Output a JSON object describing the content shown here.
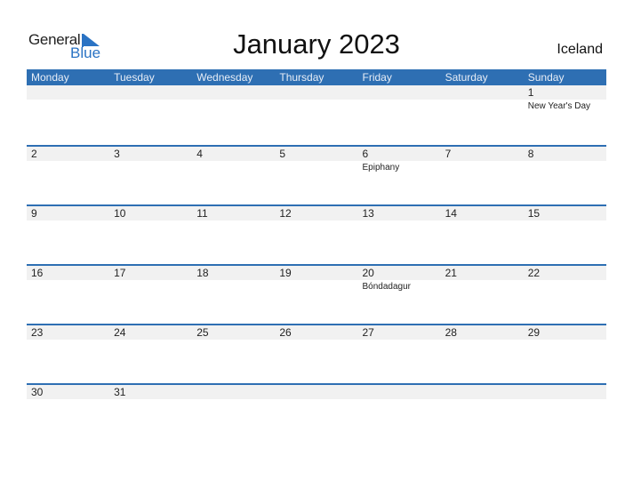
{
  "logo": {
    "general": "General",
    "blue": "Blue"
  },
  "title": "January 2023",
  "country": "Iceland",
  "days": [
    "Monday",
    "Tuesday",
    "Wednesday",
    "Thursday",
    "Friday",
    "Saturday",
    "Sunday"
  ],
  "weeks": [
    [
      {
        "d": ""
      },
      {
        "d": ""
      },
      {
        "d": ""
      },
      {
        "d": ""
      },
      {
        "d": ""
      },
      {
        "d": ""
      },
      {
        "d": "1",
        "h": "New Year's Day"
      }
    ],
    [
      {
        "d": "2"
      },
      {
        "d": "3"
      },
      {
        "d": "4"
      },
      {
        "d": "5"
      },
      {
        "d": "6",
        "h": "Epiphany"
      },
      {
        "d": "7"
      },
      {
        "d": "8"
      }
    ],
    [
      {
        "d": "9"
      },
      {
        "d": "10"
      },
      {
        "d": "11"
      },
      {
        "d": "12"
      },
      {
        "d": "13"
      },
      {
        "d": "14"
      },
      {
        "d": "15"
      }
    ],
    [
      {
        "d": "16"
      },
      {
        "d": "17"
      },
      {
        "d": "18"
      },
      {
        "d": "19"
      },
      {
        "d": "20",
        "h": "Bóndadagur"
      },
      {
        "d": "21"
      },
      {
        "d": "22"
      }
    ],
    [
      {
        "d": "23"
      },
      {
        "d": "24"
      },
      {
        "d": "25"
      },
      {
        "d": "26"
      },
      {
        "d": "27"
      },
      {
        "d": "28"
      },
      {
        "d": "29"
      }
    ],
    [
      {
        "d": "30"
      },
      {
        "d": "31"
      },
      {
        "d": ""
      },
      {
        "d": ""
      },
      {
        "d": ""
      },
      {
        "d": ""
      },
      {
        "d": ""
      }
    ]
  ]
}
